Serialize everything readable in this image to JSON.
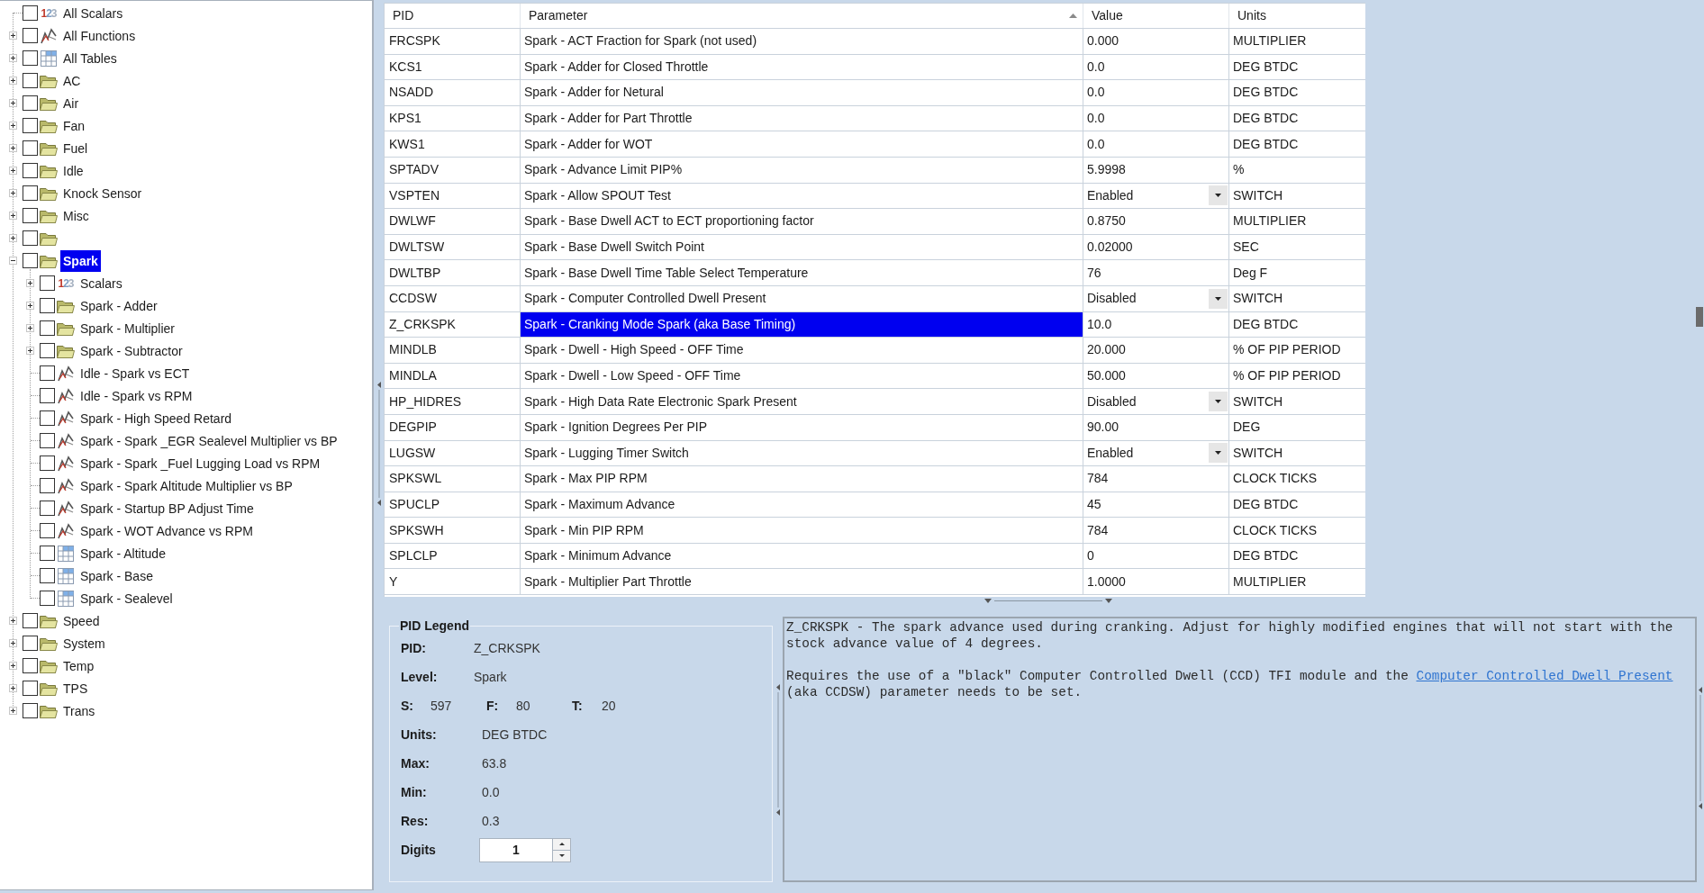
{
  "tree": {
    "items": [
      {
        "label": "All Scalars",
        "kind": "scalars",
        "icon_text": "123",
        "checked": false,
        "selected": false
      },
      {
        "label": "All Functions",
        "kind": "function",
        "checked": false,
        "selected": false,
        "expanded": false
      },
      {
        "label": "All Tables",
        "kind": "table",
        "checked": false,
        "selected": false,
        "expanded": false
      },
      {
        "label": "AC",
        "kind": "folder",
        "checked": false,
        "selected": false,
        "expanded": false
      },
      {
        "label": "Air",
        "kind": "folder",
        "checked": false,
        "selected": false,
        "expanded": false
      },
      {
        "label": "Fan",
        "kind": "folder",
        "checked": false,
        "selected": false,
        "expanded": false
      },
      {
        "label": "Fuel",
        "kind": "folder",
        "checked": false,
        "selected": false,
        "expanded": false
      },
      {
        "label": "Idle",
        "kind": "folder",
        "checked": false,
        "selected": false,
        "expanded": false
      },
      {
        "label": "Knock Sensor",
        "kind": "folder",
        "checked": false,
        "selected": false,
        "expanded": false
      },
      {
        "label": "Misc",
        "kind": "folder",
        "checked": false,
        "selected": false,
        "expanded": false
      },
      {
        "kind": "folder",
        "checked": false,
        "selected": false,
        "expanded": false
      },
      {
        "label": "Spark",
        "kind": "folder",
        "checked": false,
        "selected": true,
        "expanded": true,
        "children": [
          {
            "label": "Scalars",
            "kind": "scalars",
            "icon_text": "123",
            "checked": false,
            "selected": false,
            "expanded": false
          },
          {
            "label": "Spark - Adder",
            "kind": "folder",
            "checked": false,
            "selected": false,
            "expanded": false
          },
          {
            "label": "Spark - Multiplier",
            "kind": "folder",
            "checked": false,
            "selected": false,
            "expanded": false
          },
          {
            "label": "Spark - Subtractor",
            "kind": "folder",
            "checked": false,
            "selected": false,
            "expanded": false
          },
          {
            "label": "Idle - Spark vs ECT",
            "kind": "function",
            "checked": false,
            "selected": false
          },
          {
            "label": "Idle - Spark vs RPM",
            "kind": "function",
            "checked": false,
            "selected": false
          },
          {
            "label": "Spark - High Speed Retard",
            "kind": "function",
            "checked": false,
            "selected": false
          },
          {
            "label": "Spark - Spark _EGR Sealevel Multiplier vs BP",
            "kind": "function",
            "checked": false,
            "selected": false
          },
          {
            "label": "Spark - Spark _Fuel Lugging Load vs RPM",
            "kind": "function",
            "checked": false,
            "selected": false
          },
          {
            "label": "Spark - Spark Altitude Multiplier vs BP",
            "kind": "function",
            "checked": false,
            "selected": false
          },
          {
            "label": "Spark - Startup BP Adjust Time",
            "kind": "function",
            "checked": false,
            "selected": false
          },
          {
            "label": "Spark - WOT Advance vs RPM",
            "kind": "function",
            "checked": false,
            "selected": false
          },
          {
            "label": "Spark - Altitude",
            "kind": "table",
            "checked": false,
            "selected": false
          },
          {
            "label": "Spark - Base",
            "kind": "table",
            "checked": false,
            "selected": false
          },
          {
            "label": "Spark - Sealevel",
            "kind": "table",
            "checked": false,
            "selected": false
          }
        ]
      },
      {
        "label": "Speed",
        "kind": "folder",
        "checked": false,
        "selected": false,
        "expanded": false
      },
      {
        "label": "System",
        "kind": "folder",
        "checked": false,
        "selected": false,
        "expanded": false
      },
      {
        "label": "Temp",
        "kind": "folder",
        "checked": false,
        "selected": false,
        "expanded": false
      },
      {
        "label": "TPS",
        "kind": "folder",
        "checked": false,
        "selected": false,
        "expanded": false
      },
      {
        "label": "Trans",
        "kind": "folder",
        "checked": false,
        "selected": false,
        "expanded": false
      }
    ]
  },
  "table": {
    "columns": [
      {
        "label": "PID",
        "sorted": false
      },
      {
        "label": "Parameter",
        "sorted": true
      },
      {
        "label": "Value",
        "sorted": false
      },
      {
        "label": "Units",
        "sorted": false
      }
    ],
    "rows": [
      {
        "pid": "FRCSPK",
        "parameter": "Spark - ACT Fraction for Spark (not used)",
        "value": "0.000",
        "units": "MULTIPLIER",
        "kind": "text",
        "selected": false
      },
      {
        "pid": "KCS1",
        "parameter": "Spark - Adder for Closed Throttle",
        "value": "0.0",
        "units": "DEG BTDC",
        "kind": "text",
        "selected": false
      },
      {
        "pid": "NSADD",
        "parameter": "Spark - Adder for Netural",
        "value": "0.0",
        "units": "DEG BTDC",
        "kind": "text",
        "selected": false
      },
      {
        "pid": "KPS1",
        "parameter": "Spark - Adder for Part Throttle",
        "value": "0.0",
        "units": "DEG BTDC",
        "kind": "text",
        "selected": false
      },
      {
        "pid": "KWS1",
        "parameter": "Spark - Adder for WOT",
        "value": "0.0",
        "units": "DEG BTDC",
        "kind": "text",
        "selected": false
      },
      {
        "pid": "SPTADV",
        "parameter": "Spark - Advance Limit PIP%",
        "value": "5.9998",
        "units": "%",
        "kind": "text",
        "selected": false
      },
      {
        "pid": "VSPTEN",
        "parameter": "Spark - Allow SPOUT Test",
        "value": "Enabled",
        "units": "SWITCH",
        "kind": "dropdown",
        "selected": false
      },
      {
        "pid": "DWLWF",
        "parameter": "Spark - Base Dwell ACT to ECT proportioning factor",
        "value": "0.8750",
        "units": "MULTIPLIER",
        "kind": "text",
        "selected": false
      },
      {
        "pid": "DWLTSW",
        "parameter": "Spark - Base Dwell Switch Point",
        "value": "0.02000",
        "units": "SEC",
        "kind": "text",
        "selected": false
      },
      {
        "pid": "DWLTBP",
        "parameter": "Spark - Base Dwell Time Table Select Temperature",
        "value": "76",
        "units": "Deg F",
        "kind": "text",
        "selected": false
      },
      {
        "pid": "CCDSW",
        "parameter": "Spark - Computer Controlled Dwell Present",
        "value": "Disabled",
        "units": "SWITCH",
        "kind": "dropdown",
        "selected": false
      },
      {
        "pid": "Z_CRKSPK",
        "parameter": "Spark - Cranking Mode Spark (aka Base Timing)",
        "value": "10.0",
        "units": "DEG BTDC",
        "kind": "text",
        "selected": true
      },
      {
        "pid": "MINDLB",
        "parameter": "Spark - Dwell - High Speed - OFF Time",
        "value": "20.000",
        "units": "% OF PIP PERIOD",
        "kind": "text",
        "selected": false
      },
      {
        "pid": "MINDLA",
        "parameter": "Spark - Dwell - Low Speed - OFF Time",
        "value": "50.000",
        "units": "% OF PIP PERIOD",
        "kind": "text",
        "selected": false
      },
      {
        "pid": "HP_HIDRES",
        "parameter": "Spark - High Data Rate Electronic Spark Present",
        "value": "Disabled",
        "units": "SWITCH",
        "kind": "dropdown",
        "selected": false
      },
      {
        "pid": "DEGPIP",
        "parameter": "Spark - Ignition Degrees Per PIP",
        "value": "90.00",
        "units": "DEG",
        "kind": "text",
        "selected": false
      },
      {
        "pid": "LUGSW",
        "parameter": "Spark - Lugging Timer Switch",
        "value": "Enabled",
        "units": "SWITCH",
        "kind": "dropdown",
        "selected": false
      },
      {
        "pid": "SPKSWL",
        "parameter": "Spark - Max PIP RPM",
        "value": "784",
        "units": "CLOCK TICKS",
        "kind": "text",
        "selected": false
      },
      {
        "pid": "SPUCLP",
        "parameter": "Spark - Maximum Advance",
        "value": "45",
        "units": "DEG BTDC",
        "kind": "text",
        "selected": false
      },
      {
        "pid": "SPKSWH",
        "parameter": "Spark - Min PIP RPM",
        "value": "784",
        "units": "CLOCK TICKS",
        "kind": "text",
        "selected": false
      },
      {
        "pid": "SPLCLP",
        "parameter": "Spark - Minimum Advance",
        "value": "0",
        "units": "DEG BTDC",
        "kind": "text",
        "selected": false
      },
      {
        "pid": "Y",
        "parameter": "Spark - Multiplier Part Throttle",
        "value": "1.0000",
        "units": "MULTIPLIER",
        "kind": "text",
        "selected": false
      }
    ]
  },
  "legend": {
    "title": "PID Legend",
    "rows": [
      {
        "kind": "field",
        "label": "PID:",
        "value": "Z_CRKSPK"
      },
      {
        "kind": "field",
        "label": "Level:",
        "value": "Spark"
      },
      {
        "kind": "inline",
        "items": [
          {
            "label": "S:",
            "value": "597"
          },
          {
            "label": "F:",
            "value": "80"
          },
          {
            "label": "T:",
            "value": "20"
          }
        ]
      },
      {
        "kind": "field",
        "label": "Units:",
        "value": "DEG BTDC"
      },
      {
        "kind": "field",
        "label": "Max:",
        "value": "63.8"
      },
      {
        "kind": "field",
        "label": "Min:",
        "value": "0.0"
      },
      {
        "kind": "field",
        "label": "Res:",
        "value": "0.3"
      },
      {
        "kind": "spinner",
        "label": "Digits",
        "value": "1"
      }
    ]
  },
  "description": {
    "paragraphs": [
      {
        "segments": [
          {
            "kind": "text",
            "text": "Z_CRKSPK - The spark advance used during cranking. Adjust for highly modified engines that will not start with the stock advance value of 4 degrees."
          }
        ]
      },
      {
        "segments": [
          {
            "kind": "text",
            "text": "Requires the use of a \"black\" Computer Controlled Dwell (CCD) TFI module and the "
          },
          {
            "kind": "link",
            "text": "Computer Controlled Dwell Present"
          },
          {
            "kind": "text",
            "text": " (aka CCDSW) parameter needs to be set."
          }
        ]
      }
    ]
  }
}
